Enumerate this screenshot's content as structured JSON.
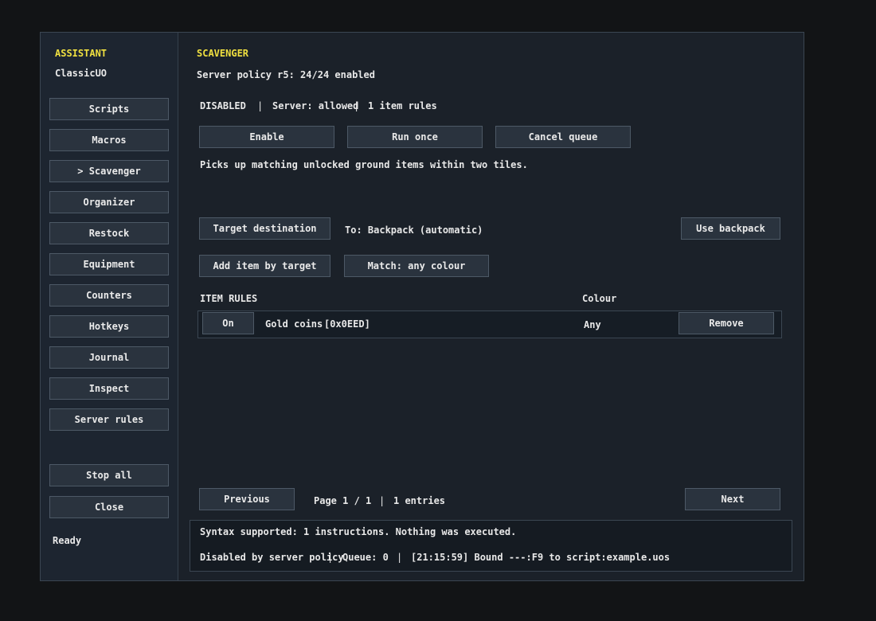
{
  "sidebar": {
    "title": "ASSISTANT",
    "subtitle": "ClassicUO",
    "items": [
      {
        "label": "Scripts"
      },
      {
        "label": "Macros"
      },
      {
        "label": "> Scavenger"
      },
      {
        "label": "Organizer"
      },
      {
        "label": "Restock"
      },
      {
        "label": "Equipment"
      },
      {
        "label": "Counters"
      },
      {
        "label": "Hotkeys"
      },
      {
        "label": "Journal"
      },
      {
        "label": "Inspect"
      },
      {
        "label": "Server rules"
      }
    ],
    "stop_all": "Stop all",
    "close": "Close",
    "status": "Ready"
  },
  "main": {
    "title": "SCAVENGER",
    "policy": "Server policy r5: 24/24 enabled",
    "state": "DISABLED",
    "sep": "|",
    "server": "Server: allowed",
    "rules_count": "1 item rules",
    "buttons": {
      "enable": "Enable",
      "run_once": "Run once",
      "cancel_queue": "Cancel queue"
    },
    "description": "Picks up matching unlocked ground items within two tiles.",
    "target_destination": "Target destination",
    "destination": "To: Backpack (automatic)",
    "use_backpack": "Use backpack",
    "add_item": "Add item by target",
    "match_colour": "Match: any colour",
    "rules_header": "ITEM RULES",
    "colour_header": "Colour",
    "rules": [
      {
        "toggle": "On",
        "name": "Gold coins",
        "id": "[0x0EED]",
        "colour": "Any",
        "remove": "Remove"
      }
    ],
    "pager": {
      "previous": "Previous",
      "page": "Page 1 / 1",
      "entries": "1 entries",
      "next": "Next"
    }
  },
  "log": {
    "line1": "Syntax supported: 1 instructions. Nothing was executed.",
    "policy": "Disabled by server policy",
    "queue": "Queue: 0",
    "bound": "[21:15:59] Bound ---:F9 to script:example.uos"
  },
  "colors": {
    "accent": "#f0e040",
    "background": "#1b2129",
    "button": "#2a333e"
  }
}
